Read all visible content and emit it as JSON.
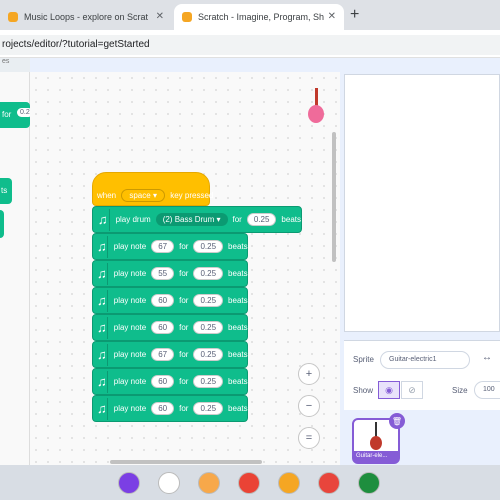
{
  "browser": {
    "tabs": [
      {
        "title": "Music Loops - explore on Scrat",
        "close": "✕"
      },
      {
        "title": "Scratch - Imagine, Program, Sh",
        "close": "✕"
      }
    ],
    "new_tab": "+",
    "url": "rojects/editor/?tutorial=getStarted"
  },
  "palette": {
    "category_strip": "es",
    "block_for": "for",
    "block_value": "0.2",
    "block_ts": "ts"
  },
  "script": {
    "hat": {
      "when": "when",
      "key": "space",
      "rest": "key pressed"
    },
    "drum_block": {
      "play_drum": "play drum",
      "drum": "(2) Bass Drum",
      "for": "for",
      "beats_value": "0.25",
      "beats": "beats"
    },
    "note_blocks": [
      {
        "label": "play note",
        "note": "67",
        "for": "for",
        "beats_value": "0.25",
        "beats": "beats"
      },
      {
        "label": "play note",
        "note": "55",
        "for": "for",
        "beats_value": "0.25",
        "beats": "beats"
      },
      {
        "label": "play note",
        "note": "60",
        "for": "for",
        "beats_value": "0.25",
        "beats": "beats"
      },
      {
        "label": "play note",
        "note": "60",
        "for": "for",
        "beats_value": "0.25",
        "beats": "beats"
      },
      {
        "label": "play note",
        "note": "67",
        "for": "for",
        "beats_value": "0.25",
        "beats": "beats"
      },
      {
        "label": "play note",
        "note": "60",
        "for": "for",
        "beats_value": "0.25",
        "beats": "beats"
      },
      {
        "label": "play note",
        "note": "60",
        "for": "for",
        "beats_value": "0.25",
        "beats": "beats"
      }
    ]
  },
  "zoom": {
    "in": "+",
    "out": "−",
    "reset": "="
  },
  "sprite_info": {
    "sprite_label": "Sprite",
    "sprite_name": "Guitar-electric1",
    "show_label": "Show",
    "size_label": "Size",
    "size_value": "100"
  },
  "sprite_list": {
    "thumb_caption": "Guitar-ele..."
  },
  "shelf": {
    "apps": [
      {
        "icon": "media-app-icon",
        "color": "#7b3fe4"
      },
      {
        "icon": "document-app-icon",
        "color": "#ffffff"
      },
      {
        "icon": "scratchjr-cat-icon",
        "color": "#f7a84a"
      },
      {
        "icon": "chrome-icon",
        "color": "#ea4335"
      },
      {
        "icon": "scratch-icon",
        "color": "#f5a623"
      },
      {
        "icon": "palette-app-icon",
        "color": "#e8453c"
      },
      {
        "icon": "classroom-app-icon",
        "color": "#1e8e3e"
      }
    ]
  },
  "colors": {
    "events": "#ffbf00",
    "music": "#0fbd8c",
    "accent": "#855cd6"
  }
}
